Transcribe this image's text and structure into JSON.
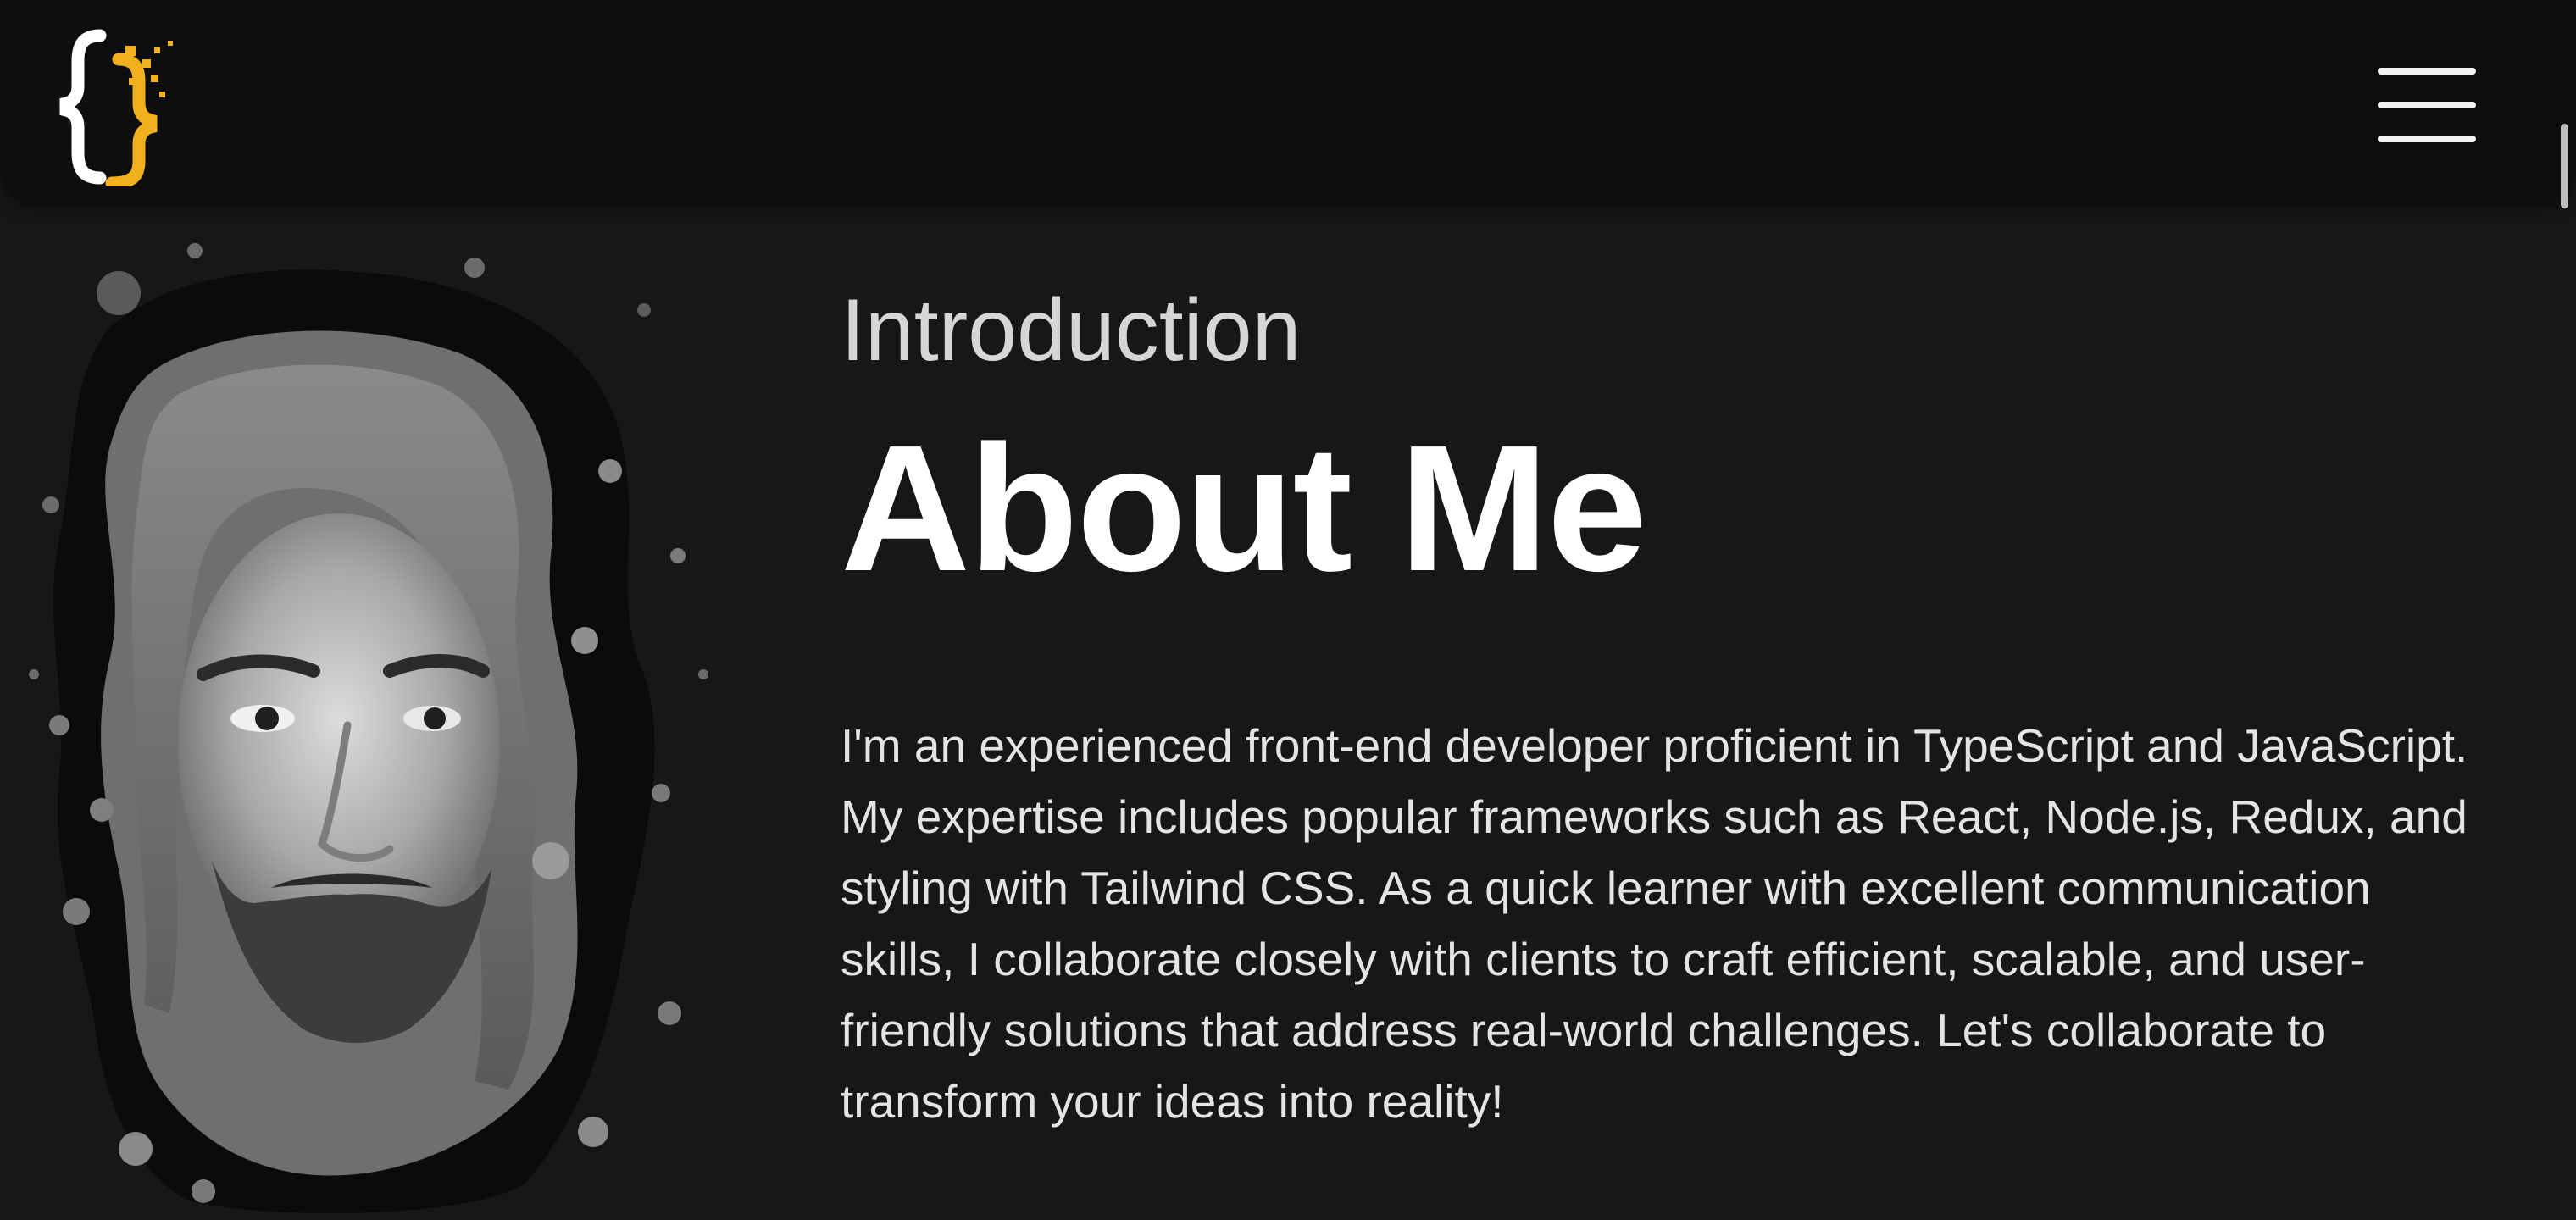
{
  "header": {
    "logo_icon": "curly-braces-logo-icon",
    "menu_icon": "hamburger-menu-icon"
  },
  "colors": {
    "background": "#171717",
    "header_background": "#0e0e0e",
    "accent": "#f2b01e",
    "text": "#ffffff"
  },
  "about": {
    "eyebrow": "Introduction",
    "title": "About Me",
    "paragraph": "I'm an experienced front-end developer proficient in TypeScript and JavaScript. My expertise includes popular frameworks such as React, Node.js, Redux, and styling with Tailwind CSS. As a quick learner with excellent communication skills, I collaborate closely with clients to craft efficient, scalable, and user-friendly solutions that address real-world challenges. Let's collaborate to transform your ideas into reality!"
  },
  "portrait": {
    "icon": "grayscale-portrait-splatter-image"
  }
}
